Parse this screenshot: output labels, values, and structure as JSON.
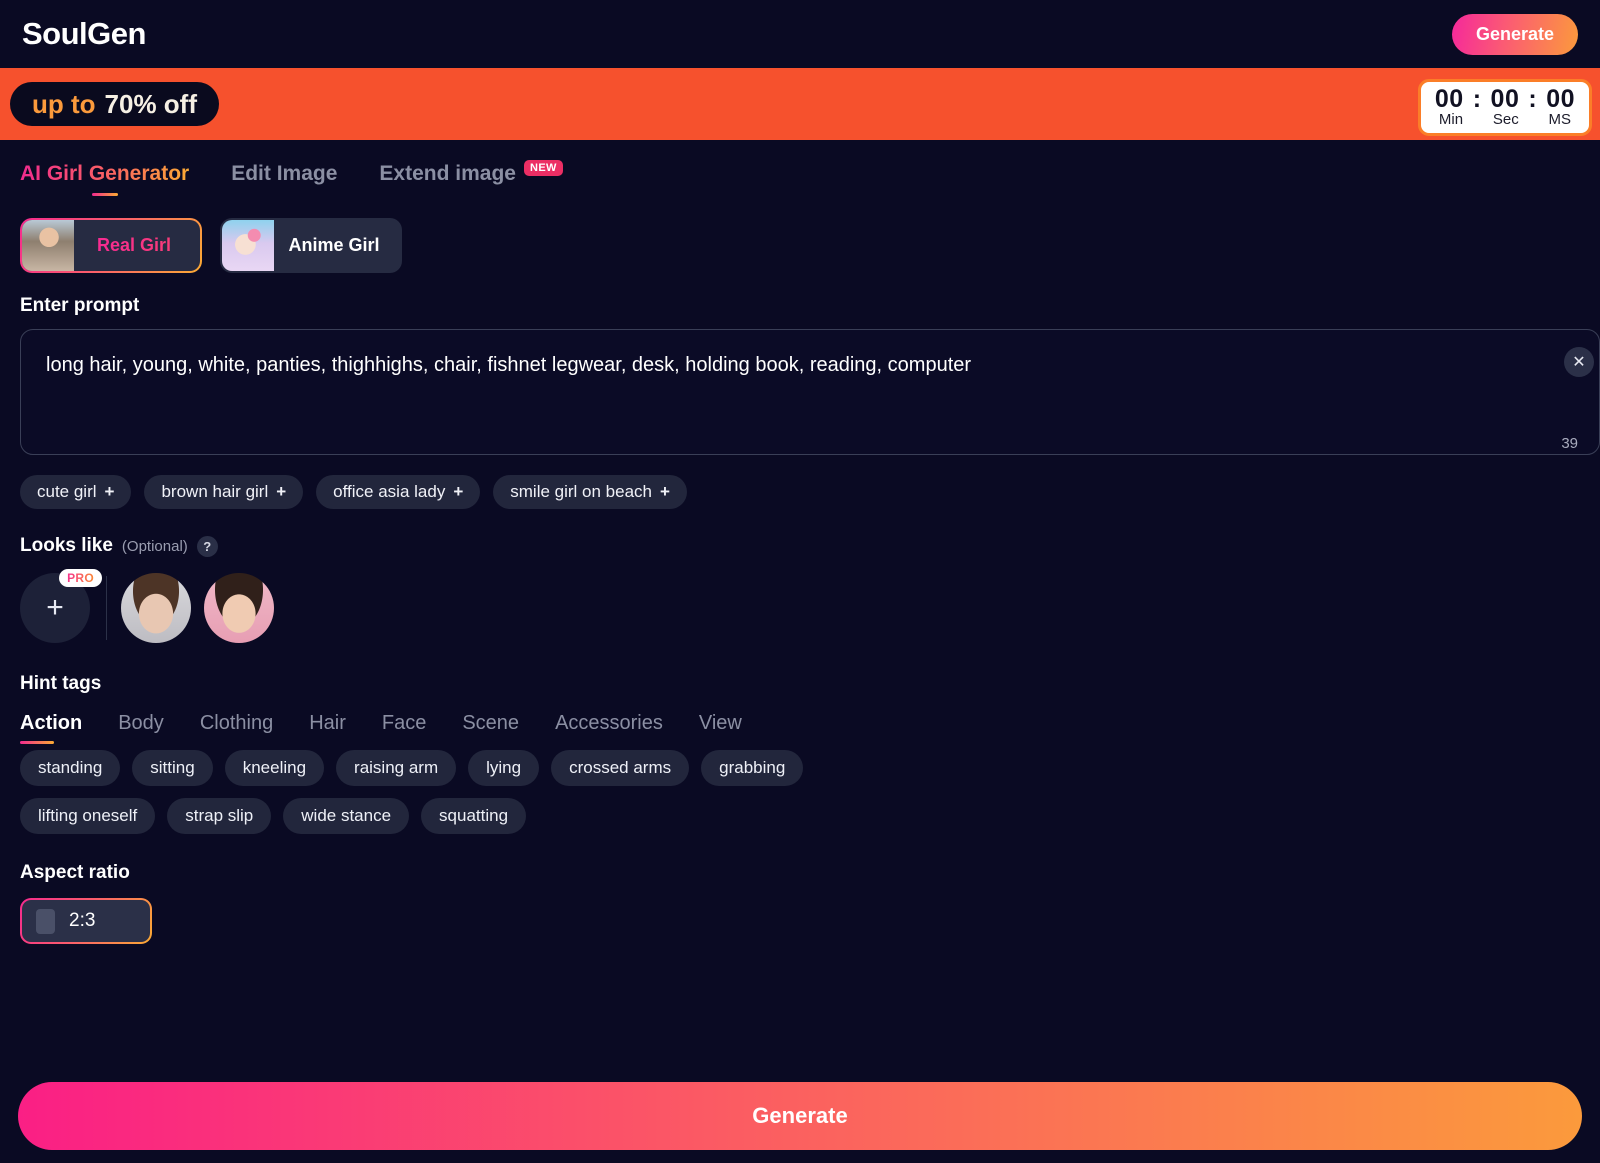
{
  "header": {
    "logo": "SoulGen",
    "generate_label": "Generate"
  },
  "banner": {
    "upto_text": "up to",
    "percent_text": "70% off",
    "timer": {
      "min_value": "00",
      "sep1": ":",
      "sec_value": "00",
      "sep2": ":",
      "ms_value": "00",
      "min_label": "Min",
      "sec_label": "Sec",
      "ms_label": "MS"
    }
  },
  "tabs": [
    {
      "label": "AI Girl Generator",
      "active": true,
      "badge": ""
    },
    {
      "label": "Edit Image",
      "active": false,
      "badge": ""
    },
    {
      "label": "Extend image",
      "active": false,
      "badge": "NEW"
    }
  ],
  "modes": [
    {
      "label": "Real Girl",
      "selected": true
    },
    {
      "label": "Anime Girl",
      "selected": false
    }
  ],
  "prompt": {
    "label": "Enter prompt",
    "value": "long hair, young, white, panties, thighhighs, chair, fishnet legwear, desk, holding book, reading, computer",
    "placeholder": "Enter prompt",
    "clear_icon": "close-icon",
    "char_count": "39"
  },
  "suggestions": [
    {
      "label": "cute girl",
      "plus": "+"
    },
    {
      "label": "brown hair girl",
      "plus": "+"
    },
    {
      "label": "office asia lady",
      "plus": "+"
    },
    {
      "label": "smile girl on beach",
      "plus": "+"
    }
  ],
  "looks_like": {
    "label": "Looks like",
    "optional": "(Optional)",
    "help": "?",
    "add_icon": "+",
    "pro_badge": "PRO"
  },
  "hint_tags": {
    "label": "Hint tags",
    "categories": [
      {
        "label": "Action",
        "active": true
      },
      {
        "label": "Body",
        "active": false
      },
      {
        "label": "Clothing",
        "active": false
      },
      {
        "label": "Hair",
        "active": false
      },
      {
        "label": "Face",
        "active": false
      },
      {
        "label": "Scene",
        "active": false
      },
      {
        "label": "Accessories",
        "active": false
      },
      {
        "label": "View",
        "active": false
      }
    ],
    "tags": [
      "standing",
      "sitting",
      "kneeling",
      "raising arm",
      "lying",
      "crossed arms",
      "grabbing",
      "lifting oneself",
      "strap slip",
      "wide stance",
      "squatting"
    ]
  },
  "aspect_ratio": {
    "label": "Aspect ratio",
    "options": [
      {
        "label": "2:3",
        "selected": true
      }
    ]
  },
  "cta": {
    "label": "Generate"
  },
  "colors": {
    "page_bg": "#0a0a23",
    "banner_bg": "#f6512d",
    "accent_pink": "#f52a8e",
    "accent_orange": "#fb9a3c",
    "badge_new": "#ec2e64",
    "chip_bg": "#22263c"
  }
}
